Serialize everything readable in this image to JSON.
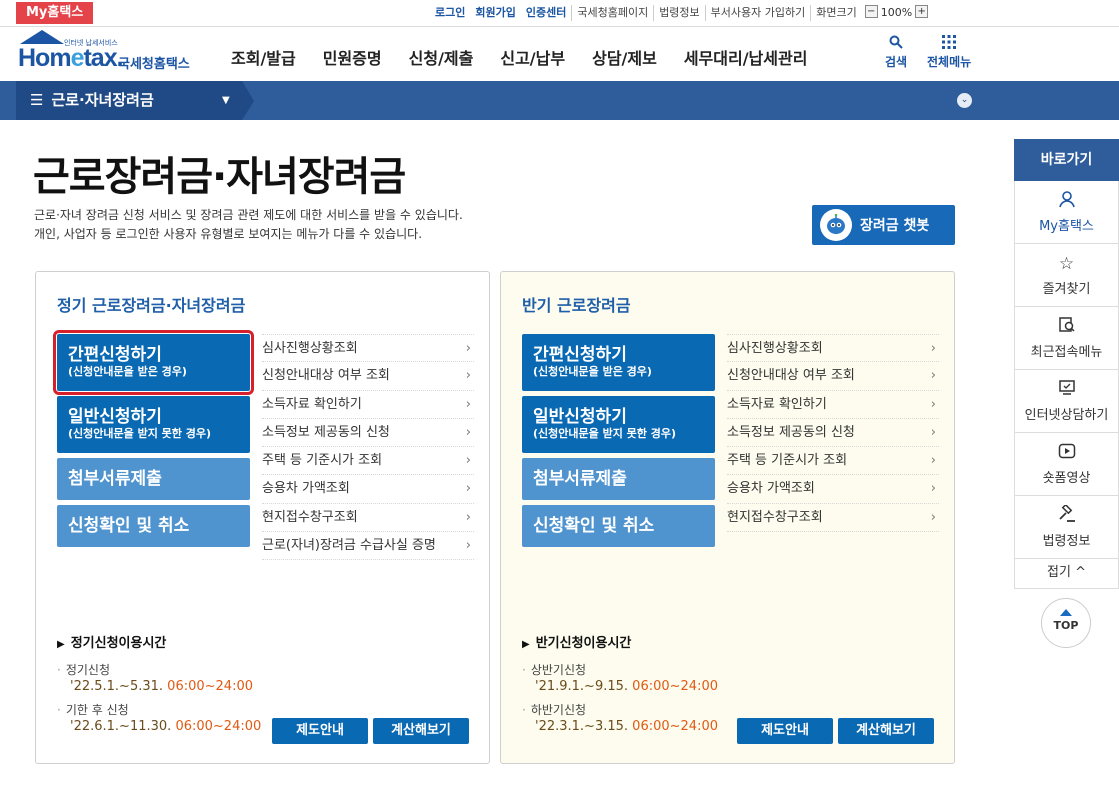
{
  "topbar": {
    "myhometax_tab": "My홈택스",
    "util_links": [
      "로그인",
      "회원가입",
      "인증센터",
      "국세청홈페이지",
      "법령정보",
      "부서사용자 가입하기",
      "화면크기"
    ],
    "zoom_level": "100%",
    "zoom_minus": "−",
    "zoom_plus": "+"
  },
  "header": {
    "logo_sub": "인터넷 납세서비스",
    "logo_main_a": "Hom",
    "logo_main_e": "e",
    "logo_main_b": "tax.",
    "logo_kr": "국세청홈택스",
    "nav": [
      "조회/발급",
      "민원증명",
      "신청/제출",
      "신고/납부",
      "상담/제보",
      "세무대리/납세관리"
    ],
    "search_label": "검색",
    "allmenu_label": "전체메뉴"
  },
  "location": {
    "current": "근로·자녀장려금"
  },
  "page": {
    "title": "근로장려금·자녀장려금",
    "desc_line1": "근로·자녀 장려금 신청 서비스 및 장려금 관련 제도에 대한 서비스를 받을 수 있습니다.",
    "desc_line2": "개인, 사업자 등 로그인한 사용자 유형별로 보여지는 메뉴가 다를 수 있습니다.",
    "chatbot_label": "장려금 챗봇"
  },
  "left_panel": {
    "title": "정기 근로장려금·자녀장려금",
    "btn_simple_l1": "간편신청하기",
    "btn_simple_l2": "(신청안내문을 받은 경우)",
    "btn_general_l1": "일반신청하기",
    "btn_general_l2": "(신청안내문을 받지 못한 경우)",
    "btn_docs": "첨부서류제출",
    "btn_confirm": "신청확인 및 취소",
    "links": [
      "심사진행상황조회",
      "신청안내대상 여부 조회",
      "소득자료 확인하기",
      "소득정보 제공동의 신청",
      "주택 등 기준시가 조회",
      "승용차 가액조회",
      "현지접수창구조회",
      "근로(자녀)장려금 수급사실 증명"
    ],
    "hours_title": "정기신청이용시간",
    "item1_label": "정기신청",
    "item1_date": "'22.5.1.~5.31.",
    "item1_time": "06:00~24:00",
    "item2_label": "기한 후 신청",
    "item2_date": "'22.6.1.~11.30.",
    "item2_time": "06:00~24:00",
    "btn_guide": "제도안내",
    "btn_calc": "계산해보기"
  },
  "right_panel": {
    "title": "반기 근로장려금",
    "btn_simple_l1": "간편신청하기",
    "btn_simple_l2": "(신청안내문을 받은 경우)",
    "btn_general_l1": "일반신청하기",
    "btn_general_l2": "(신청안내문을 받지 못한 경우)",
    "btn_docs": "첨부서류제출",
    "btn_confirm": "신청확인 및 취소",
    "links": [
      "심사진행상황조회",
      "신청안내대상 여부 조회",
      "소득자료 확인하기",
      "소득정보 제공동의 신청",
      "주택 등 기준시가 조회",
      "승용차 가액조회",
      "현지접수창구조회"
    ],
    "hours_title": "반기신청이용시간",
    "item1_label": "상반기신청",
    "item1_date": "'21.9.1.~9.15.",
    "item1_time": "06:00~24:00",
    "item2_label": "하반기신청",
    "item2_date": "'22.3.1.~3.15.",
    "item2_time": "06:00~24:00",
    "btn_guide": "제도안내",
    "btn_calc": "계산해보기"
  },
  "quick": {
    "header": "바로가기",
    "items": [
      {
        "label": "My홈택스",
        "icon": "person-icon"
      },
      {
        "label": "즐겨찾기",
        "icon": "star-icon"
      },
      {
        "label": "최근접속메뉴",
        "icon": "recent-icon"
      },
      {
        "label": "인터넷상담하기",
        "icon": "monitor-icon"
      },
      {
        "label": "숏폼영상",
        "icon": "play-icon"
      },
      {
        "label": "법령정보",
        "icon": "gavel-icon"
      }
    ],
    "fold_label": "접기 ^",
    "top_label": "TOP"
  },
  "colors": {
    "brand_blue": "#1b55a3",
    "button_dark": "#0a69b3",
    "button_light": "#4f93cf",
    "highlight_red": "#d6202b",
    "time_orange": "#e05a12"
  }
}
